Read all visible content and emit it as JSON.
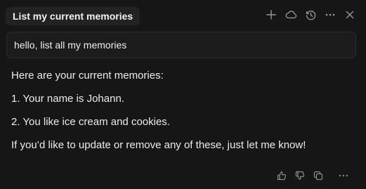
{
  "header": {
    "title": "List my current memories",
    "icons": [
      "plus-icon",
      "cloud-icon",
      "history-icon",
      "more-icon",
      "close-icon"
    ]
  },
  "user_message": {
    "text": "hello, list all my memories"
  },
  "response": {
    "intro": "Here are your current memories:",
    "items": [
      "1. Your name is Johann.",
      "2. You like ice cream and cookies."
    ],
    "outro": "If you’d like to update or remove any of these, just let me know!"
  },
  "actions": {
    "icons": [
      "thumbs-up-icon",
      "thumbs-down-icon",
      "copy-icon",
      "more-icon"
    ]
  },
  "colors": {
    "background": "#161616",
    "chip_background": "#222222",
    "message_background": "#1c1c1c",
    "text": "#ececec",
    "icon": "#9a9a9a"
  }
}
